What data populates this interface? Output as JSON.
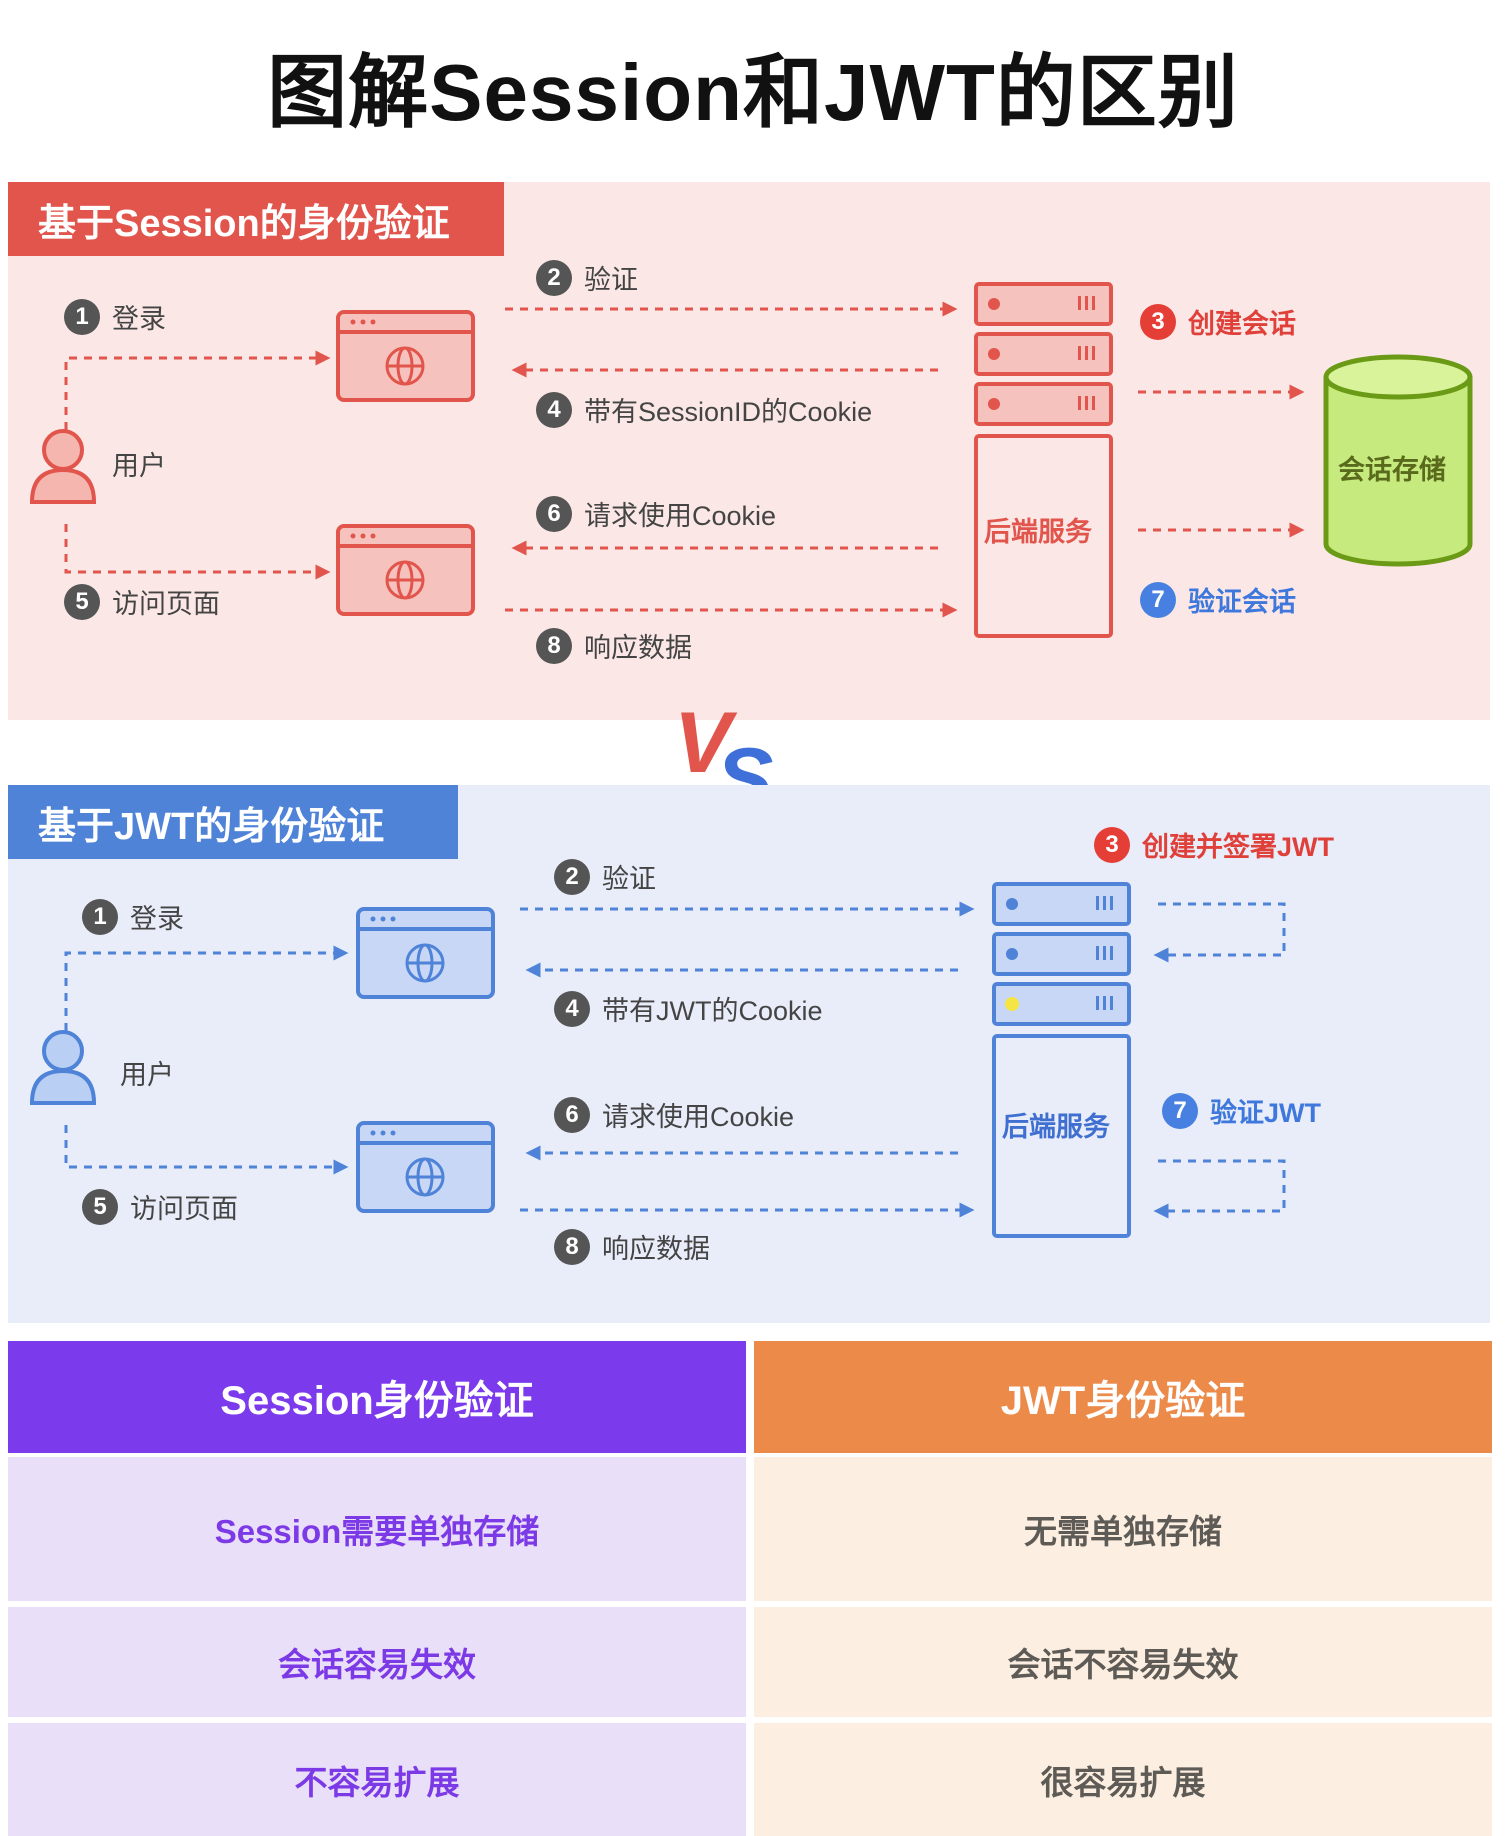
{
  "title": "图解Session和JWT的区别",
  "session_panel": {
    "header": "基于Session的身份验证",
    "user_label": "用户",
    "steps": [
      {
        "num": "1",
        "text": "登录"
      },
      {
        "num": "2",
        "text": "验证"
      },
      {
        "num": "3",
        "text": "创建会话"
      },
      {
        "num": "4",
        "text": "带有SessionID的Cookie"
      },
      {
        "num": "5",
        "text": "访问页面"
      },
      {
        "num": "6",
        "text": "请求使用Cookie"
      },
      {
        "num": "7",
        "text": "验证会话"
      },
      {
        "num": "8",
        "text": "响应数据"
      }
    ],
    "server_label": "后端服务",
    "store_label": "会话存储"
  },
  "vs_label": "VS",
  "jwt_panel": {
    "header": "基于JWT的身份验证",
    "user_label": "用户",
    "steps": [
      {
        "num": "1",
        "text": "登录"
      },
      {
        "num": "2",
        "text": "验证"
      },
      {
        "num": "3",
        "text": "创建并签署JWT"
      },
      {
        "num": "4",
        "text": "带有JWT的Cookie"
      },
      {
        "num": "5",
        "text": "访问页面"
      },
      {
        "num": "6",
        "text": "请求使用Cookie"
      },
      {
        "num": "7",
        "text": "验证JWT"
      },
      {
        "num": "8",
        "text": "响应数据"
      }
    ],
    "server_label": "后端服务"
  },
  "comparison": {
    "headers": [
      "Session身份验证",
      "JWT身份验证"
    ],
    "rows": [
      [
        "Session需要单独存储",
        "无需单独存储"
      ],
      [
        "会话容易失效",
        "会话不容易失效"
      ],
      [
        "不容易扩展",
        "很容易扩展"
      ]
    ]
  },
  "colors": {
    "session_accent": "#e1554c",
    "jwt_accent": "#4f83d8",
    "store_fill": "#c6ea7d",
    "table_left_header": "#7c3aed",
    "table_right_header": "#ec8a4a"
  },
  "icons": [
    "user-icon",
    "browser-window-icon",
    "globe-icon",
    "server-rack-icon",
    "database-icon",
    "arrow-icon"
  ]
}
